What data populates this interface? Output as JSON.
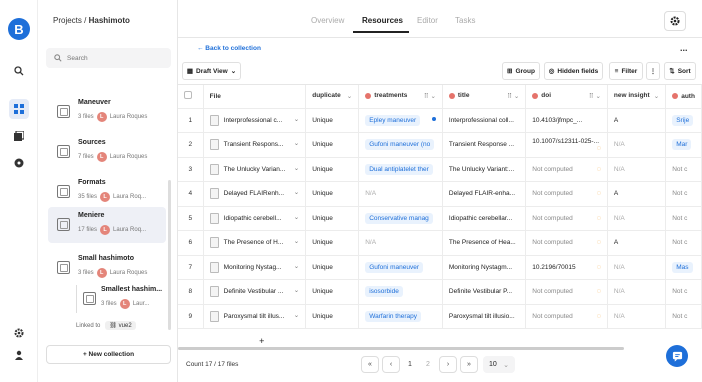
{
  "sidebar": {
    "breadcrumb_root": "Projects",
    "breadcrumb_sep": "/",
    "breadcrumb_current": "Hashimoto",
    "search_placeholder": "Search",
    "collections": [
      {
        "name": "Maneuver",
        "files": "3 files",
        "owner": "Laura Roques",
        "avatar": "L"
      },
      {
        "name": "Sources",
        "files": "7 files",
        "owner": "Laura Roques",
        "avatar": "L"
      },
      {
        "name": "Formats",
        "files": "35 files",
        "owner": "Laura Roq...",
        "avatar": "L"
      },
      {
        "name": "Meniere",
        "files": "17 files",
        "owner": "Laura Roq...",
        "avatar": "L"
      },
      {
        "name": "Small hashimoto",
        "files": "3 files",
        "owner": "Laura Roques",
        "avatar": "L"
      }
    ],
    "subcollection": {
      "name": "Smallest hashim...",
      "files": "3 files",
      "owner": "Laur...",
      "avatar": "L"
    },
    "linked_label": "Linked to",
    "linked_value": "vue2",
    "new_collection": "+ New collection"
  },
  "tabs": [
    "Overview",
    "Resources",
    "Editor",
    "Tasks"
  ],
  "back_link": "← Back to collection",
  "more": "...",
  "toolbar": {
    "view": "Draft View",
    "group": "Group",
    "hidden_fields": "Hidden fields",
    "filter": "Filter",
    "kebab": "⋮",
    "sort": "Sort"
  },
  "table": {
    "columns": [
      "File",
      "duplicate",
      "treatments",
      "title",
      "doi",
      "new insight",
      "auth"
    ],
    "rows": [
      {
        "n": "1",
        "file": "Interprofessional c...",
        "dup": "Unique",
        "treat": "Epley maneuver",
        "title": "Interprofessional coll...",
        "doi": "10.4103/jfmpc_...",
        "insight": "A",
        "auth": "Srije"
      },
      {
        "n": "2",
        "file": "Transient Respons...",
        "dup": "Unique",
        "treat": "Gufoni maneuver (no",
        "title": "Transient Response ...",
        "doi": "10.1007/s12311-025-...",
        "insight": "N/A",
        "auth": "Mar"
      },
      {
        "n": "3",
        "file": "The Unlucky Varian...",
        "dup": "Unique",
        "treat": "Dual antiplatelet ther",
        "title": "The Unlucky Variant:...",
        "doi": "Not computed",
        "insight": "N/A",
        "auth": "Not c"
      },
      {
        "n": "4",
        "file": "Delayed FLAIRenh...",
        "dup": "Unique",
        "treat": "N/A",
        "title": "Delayed FLAIR-enha...",
        "doi": "Not computed",
        "insight": "A",
        "auth": "Not c"
      },
      {
        "n": "5",
        "file": "Idiopathic cerebell...",
        "dup": "Unique",
        "treat": "Conservative manag",
        "title": "Idiopathic cerebellar...",
        "doi": "Not computed",
        "insight": "N/A",
        "auth": "Not c"
      },
      {
        "n": "6",
        "file": "The Presence of H...",
        "dup": "Unique",
        "treat": "N/A",
        "title": "The Presence of Hea...",
        "doi": "Not computed",
        "insight": "A",
        "auth": "Not c"
      },
      {
        "n": "7",
        "file": "Monitoring Nystag...",
        "dup": "Unique",
        "treat": "Gufoni maneuver",
        "title": "Monitoring Nystagm...",
        "doi": "10.2196/70015",
        "insight": "N/A",
        "auth": "Mas"
      },
      {
        "n": "8",
        "file": "Definite Vestibular ...",
        "dup": "Unique",
        "treat": "isosorbide",
        "title": "Definite Vestibular P...",
        "doi": "Not computed",
        "insight": "N/A",
        "auth": "Not c"
      },
      {
        "n": "9",
        "file": "Paroxysmal tilt illus...",
        "dup": "Unique",
        "treat": "Warfarin therapy",
        "title": "Paroxysmal tilt illusio...",
        "doi": "Not computed",
        "insight": "N/A",
        "auth": "Not c"
      }
    ],
    "add_row": "+"
  },
  "footer": {
    "count": "Count 17 / 17 files",
    "first": "«",
    "prev": "‹",
    "page1": "1",
    "page2": "2",
    "next": "›",
    "last": "»",
    "page_size": "10"
  },
  "colors": {
    "accent": "#1e6fd9",
    "tag_bg": "#e9f2fd",
    "warning": "#f0a030",
    "avatar": "#e4857a"
  }
}
